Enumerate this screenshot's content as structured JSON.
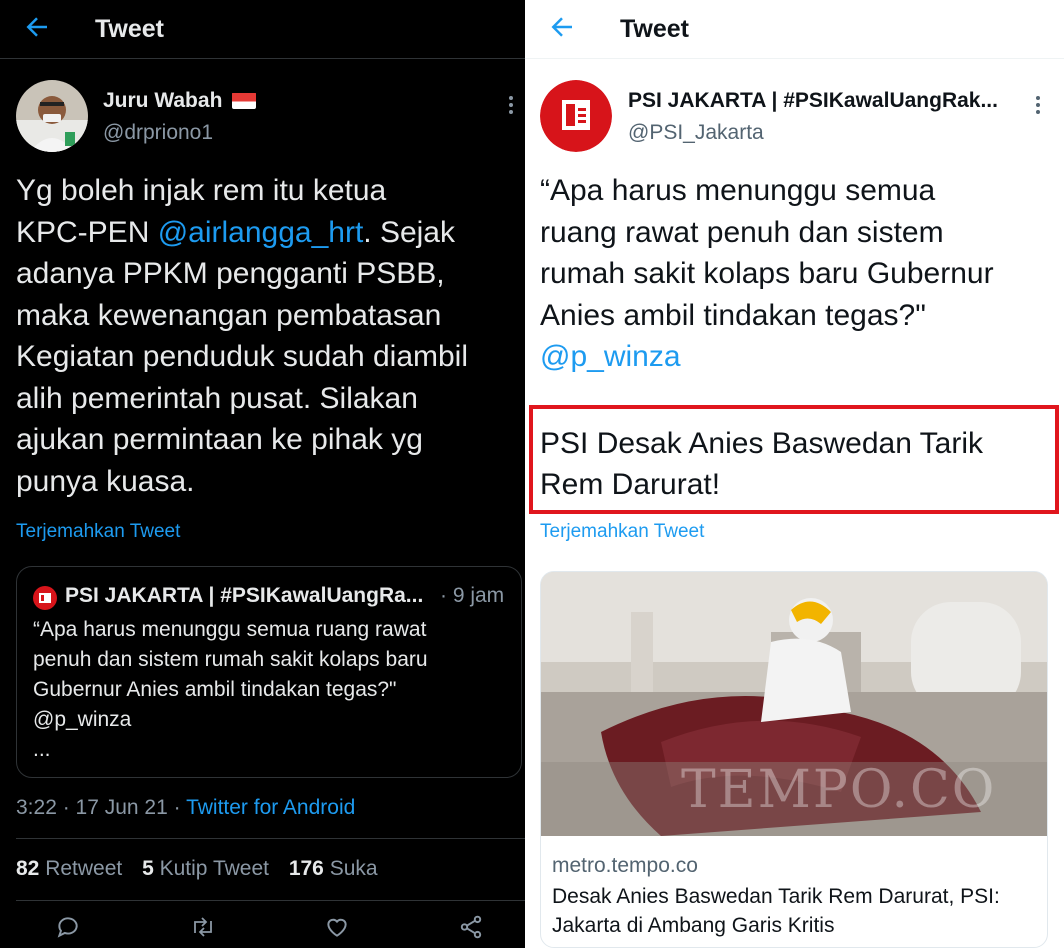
{
  "left": {
    "header_title": "Tweet",
    "author_name": "Juru Wabah",
    "author_handle": "@drpriono1",
    "body_line1": "Yg boleh injak rem itu ketua",
    "body_line2_pre": "KPC-PEN ",
    "body_mention": "@airlangga_hrt",
    "body_line2_post": ".  Sejak",
    "body_line3": "adanya PPKM pengganti PSBB,",
    "body_line4": "maka kewenangan pembatasan",
    "body_line5": "Kegiatan penduduk sudah diambil",
    "body_line6": "alih pemerintah pusat. Silakan",
    "body_line7": "ajukan permintaan ke pihak yg",
    "body_line8": "punya kuasa.",
    "translate": "Terjemahkan Tweet",
    "quote": {
      "name": "PSI JAKARTA | #PSIKawalUangRa...",
      "time": "· 9 jam",
      "line1": "“Apa harus menunggu semua ruang rawat",
      "line2": "penuh dan sistem rumah sakit kolaps baru",
      "line3": "Gubernur Anies ambil tindakan tegas?\"",
      "line4": "@p_winza",
      "line5": "..."
    },
    "meta_time": "3:22 · 17 Jun 21 · ",
    "meta_source": "Twitter for Android",
    "stats": {
      "retweets": "82",
      "retweets_label": "Retweet",
      "quotes": "5",
      "quotes_label": "Kutip Tweet",
      "likes": "176",
      "likes_label": "Suka"
    }
  },
  "right": {
    "header_title": "Tweet",
    "author_name": "PSI JAKARTA | #PSIKawalUangRak...",
    "author_handle": "@PSI_Jakarta",
    "body_line1": "“Apa harus menunggu semua",
    "body_line2": "ruang rawat penuh dan sistem",
    "body_line3": "rumah sakit kolaps baru Gubernur",
    "body_line4": "Anies ambil tindakan tegas?\"",
    "body_mention": "@p_winza",
    "headline_line1": "PSI Desak Anies Baswedan Tarik",
    "headline_line2": "Rem Darurat!",
    "translate": "Terjemahkan Tweet",
    "card": {
      "watermark": "TEMPO.CO",
      "domain": "metro.tempo.co",
      "title_line1": "Desak Anies Baswedan Tarik Rem Darurat, PSI:",
      "title_line2": "Jakarta di Ambang Garis Kritis"
    }
  },
  "colors": {
    "accent": "#1d9bf0",
    "highlight_box": "#e0161d",
    "psi_red": "#d7141a"
  }
}
